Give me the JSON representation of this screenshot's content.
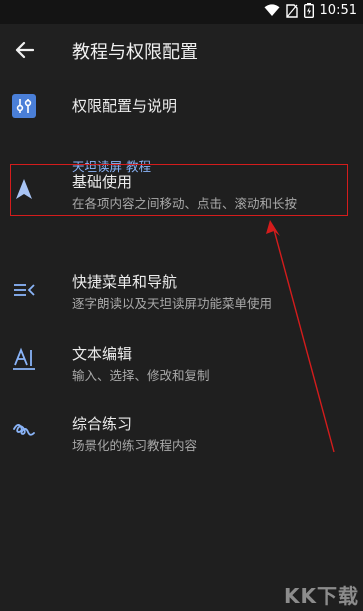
{
  "status_bar": {
    "time": "10:51",
    "icons": [
      "wifi-icon",
      "no-sim-icon",
      "battery-icon"
    ]
  },
  "app_bar": {
    "back_icon": "back-arrow-icon",
    "title": "教程与权限配置"
  },
  "permissions_item": {
    "icon": "sliders-icon",
    "label": "权限配置与说明"
  },
  "section": {
    "header": "天坦读屏 教程"
  },
  "tutorials": [
    {
      "icon": "navigation-arrow-icon",
      "title": "基础使用",
      "subtitle": "在各项内容之间移动、点击、滚动和长按"
    },
    {
      "icon": "menu-nav-icon",
      "title": "快捷菜单和导航",
      "subtitle": "逐字朗读以及天坦读屏功能菜单使用"
    },
    {
      "icon": "text-edit-icon",
      "title": "文本编辑",
      "subtitle": "输入、选择、修改和复制"
    },
    {
      "icon": "gesture-icon",
      "title": "综合练习",
      "subtitle": "场景化的练习教程内容"
    }
  ],
  "colors": {
    "background": "#1f1f1f",
    "accent": "#8ab4f8",
    "annotation": "#d41c1c"
  },
  "watermark": "KK下载"
}
